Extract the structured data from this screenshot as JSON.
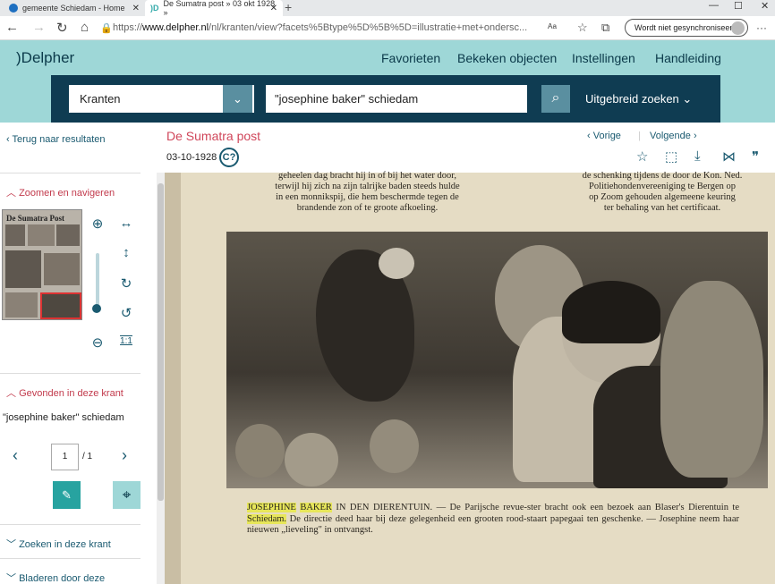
{
  "browser": {
    "tabs": [
      {
        "title": "gemeente Schiedam - Home"
      },
      {
        "title": "De Sumatra post » 03 okt 1928 »"
      }
    ],
    "url_prefix": "https://",
    "url_domain": "www.delpher.nl",
    "url_path": "/nl/kranten/view?facets%5Btype%5D%5B%5D=illustratie+met+ondersc...",
    "sync_label": "Wordt niet gesynchroniseerd"
  },
  "site": {
    "logo": ")Delpher",
    "nav": [
      "Favorieten",
      "Bekeken objecten",
      "Instellingen",
      "Handleiding"
    ],
    "search": {
      "collection": "Kranten",
      "query": "\"josephine baker\" schiedam",
      "advanced_label": "Uitgebreid zoeken"
    }
  },
  "sidebar": {
    "back_label": "Terug naar resultaten",
    "zoom_section": "Zoomen en navigeren",
    "thumb_title": "De Sumatra Post",
    "zoom_reset": "1:1",
    "found_section": "Gevonden in deze krant",
    "found_query": "\"josephine baker\" schiedam",
    "page_current": "1",
    "page_total": "/ 1",
    "search_section": "Zoeken in deze krant",
    "browse_section": "Bladeren door deze"
  },
  "article": {
    "title": "De Sumatra post",
    "date": "03-10-1928",
    "cc_label": "C?",
    "prev_label": "Vorige",
    "next_label": "Volgende"
  },
  "newspaper": {
    "left_col": [
      "geheelen dag bracht hij in of bij het water door,",
      "terwijl hij zich na zijn talrijke baden steeds hulde",
      "in een monnikspij, die hem beschermde tegen de",
      "brandende zon of te groote afkoeling."
    ],
    "right_col": [
      "de schenking tijdens de door de Kon. Ned.",
      "Politiehondenvereeniging te Bergen op",
      "op Zoom gehouden algemeene keuring",
      "ter behaling van het certificaat."
    ],
    "caption_hl1": "JOSEPHINE",
    "caption_hl2": "BAKER",
    "caption_a": " IN DEN DIERENTUIN. — De Parijsche revue-ster bracht ook een bezoek aan Blaser's Dierentuin te ",
    "caption_hl3": "Schiedam.",
    "caption_b": " De directie deed haar bij deze gelegenheid een grooten rood-staart papegaai ten geschenke. — Josephine neem haar nieuwen „lieveling\" in ontvangst."
  }
}
